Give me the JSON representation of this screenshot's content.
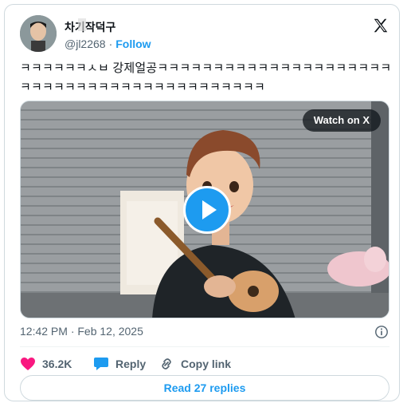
{
  "author": {
    "display_name": "차기작덕구",
    "handle": "@jl2268",
    "separator": "·",
    "follow_label": "Follow"
  },
  "icons": {
    "x_logo": "x-logo-icon",
    "play": "play-icon",
    "info": "info-icon",
    "like": "heart-icon",
    "reply": "reply-icon",
    "link": "link-icon"
  },
  "tweet": {
    "text": "ㅋㅋㅋㅋㅋㅋㅅㅂ 강제얼공ㅋㅋㅋㅋㅋㅋㅋㅋㅋㅋㅋㅋㅋㅋㅋㅋㅋㅋㅋㅋㅋㅋㅋㅋㅋㅋㅋㅋㅋㅋㅋㅋㅋㅋㅋㅋㅋㅋㅋㅋㅋㅋㅋ",
    "timestamp": "12:42 PM · Feb 12, 2025"
  },
  "media": {
    "watch_label": "Watch on X"
  },
  "actions": {
    "likes": "36.2K",
    "reply_label": "Reply",
    "copy_link_label": "Copy link"
  },
  "footer": {
    "read_replies_label": "Read 27 replies"
  },
  "colors": {
    "accent": "#1d9bf0",
    "like": "#f91880",
    "text": "#0f1419",
    "secondary": "#536471"
  }
}
